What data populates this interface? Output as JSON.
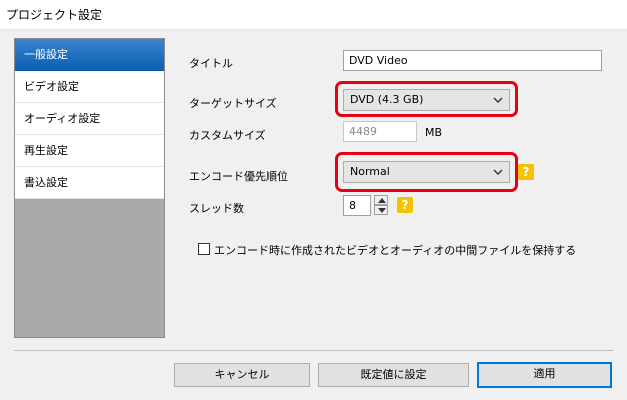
{
  "window": {
    "title": "プロジェクト設定"
  },
  "sidebar": {
    "items": [
      {
        "label": "一般設定",
        "selected": true
      },
      {
        "label": "ビデオ設定",
        "selected": false
      },
      {
        "label": "オーディオ設定",
        "selected": false
      },
      {
        "label": "再生設定",
        "selected": false
      },
      {
        "label": "書込設定",
        "selected": false
      }
    ]
  },
  "form": {
    "title_label": "タイトル",
    "title_value": "DVD Video",
    "target_size_label": "ターゲットサイズ",
    "target_size_value": "DVD (4.3 GB)",
    "custom_size_label": "カスタムサイズ",
    "custom_size_value": "4489",
    "custom_size_unit": "MB",
    "encode_priority_label": "エンコード優先順位",
    "encode_priority_value": "Normal",
    "threads_label": "スレッド数",
    "threads_value": "8",
    "keep_files_label": "エンコード時に作成されたビデオとオーディオの中間ファイルを保持する",
    "keep_files_checked": false
  },
  "help": {
    "glyph": "?"
  },
  "buttons": {
    "cancel": "キャンセル",
    "set_default": "既定値に設定",
    "apply": "適用"
  },
  "colors": {
    "highlight": "#e60012",
    "selection": "#0b5fb1",
    "help_badge": "#f5c400"
  }
}
